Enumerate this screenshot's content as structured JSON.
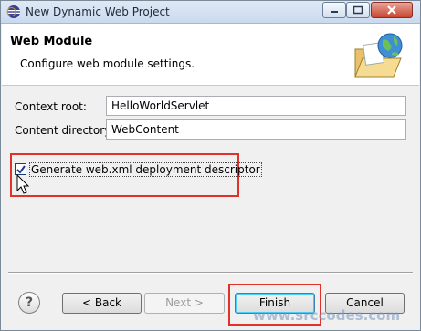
{
  "window": {
    "title": "New Dynamic Web Project"
  },
  "header": {
    "title": "Web Module",
    "description": "Configure web module settings."
  },
  "form": {
    "context_root_label": "Context root:",
    "context_root_value": "HelloWorldServlet",
    "content_dir_label": "Content directory:",
    "content_dir_value": "WebContent",
    "generate_xml_label": "Generate web.xml deployment descriptor",
    "generate_xml_checked": true
  },
  "buttons": {
    "help": "?",
    "back": "< Back",
    "next": "Next >",
    "finish": "Finish",
    "cancel": "Cancel"
  },
  "watermark": "www.srccodes.com",
  "colors": {
    "highlight": "#e0322b",
    "accent": "#3c7fb1"
  }
}
